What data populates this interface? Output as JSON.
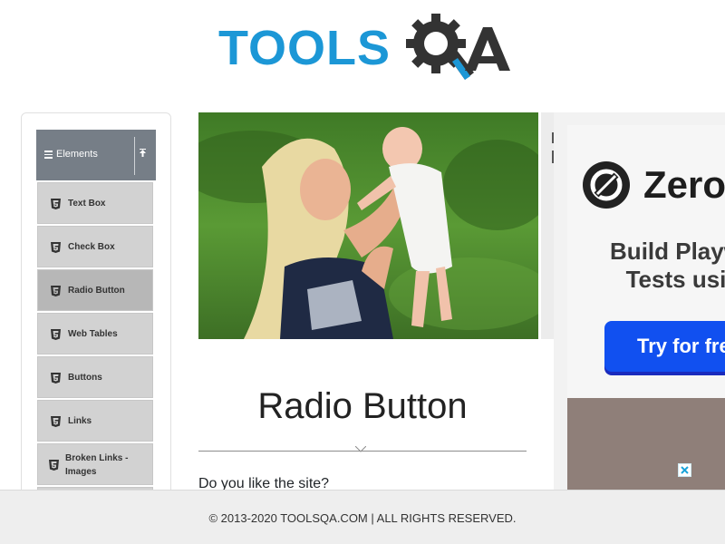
{
  "brand": {
    "logo_part1": "TOOLS",
    "logo_part2": "QA",
    "logo_gear_letter": "Q",
    "logo_last_letter": "A",
    "colors": {
      "primary_blue": "#1c97d6",
      "dark": "#333333"
    }
  },
  "sidebar": {
    "group_title": "Elements",
    "group_icons": {
      "menu": "hamburger-icon",
      "collapse": "collapse-up-icon"
    },
    "items": [
      {
        "label": "Text Box",
        "icon": "html5-icon",
        "active": false
      },
      {
        "label": "Check Box",
        "icon": "html5-icon",
        "active": false
      },
      {
        "label": "Radio Button",
        "icon": "html5-icon",
        "active": true
      },
      {
        "label": "Web Tables",
        "icon": "html5-icon",
        "active": false
      },
      {
        "label": "Buttons",
        "icon": "html5-icon",
        "active": false
      },
      {
        "label": "Links",
        "icon": "html5-icon",
        "active": false
      },
      {
        "label": "Broken Links - Images",
        "icon": "html5-icon",
        "active": false
      }
    ]
  },
  "main": {
    "title": "Radio Button",
    "question": "Do you like the site?"
  },
  "ad": {
    "brand": "Zero",
    "headline_line1": "Build Playw",
    "headline_line2": "Tests usi",
    "cta_label": "Try for fre",
    "colors": {
      "cta": "#1150f0",
      "bottom_panel": "#8f7f79"
    },
    "close_icon": "close-x-icon"
  },
  "footer": {
    "text": "© 2013-2020 TOOLSQA.COM | ALL RIGHTS RESERVED."
  }
}
